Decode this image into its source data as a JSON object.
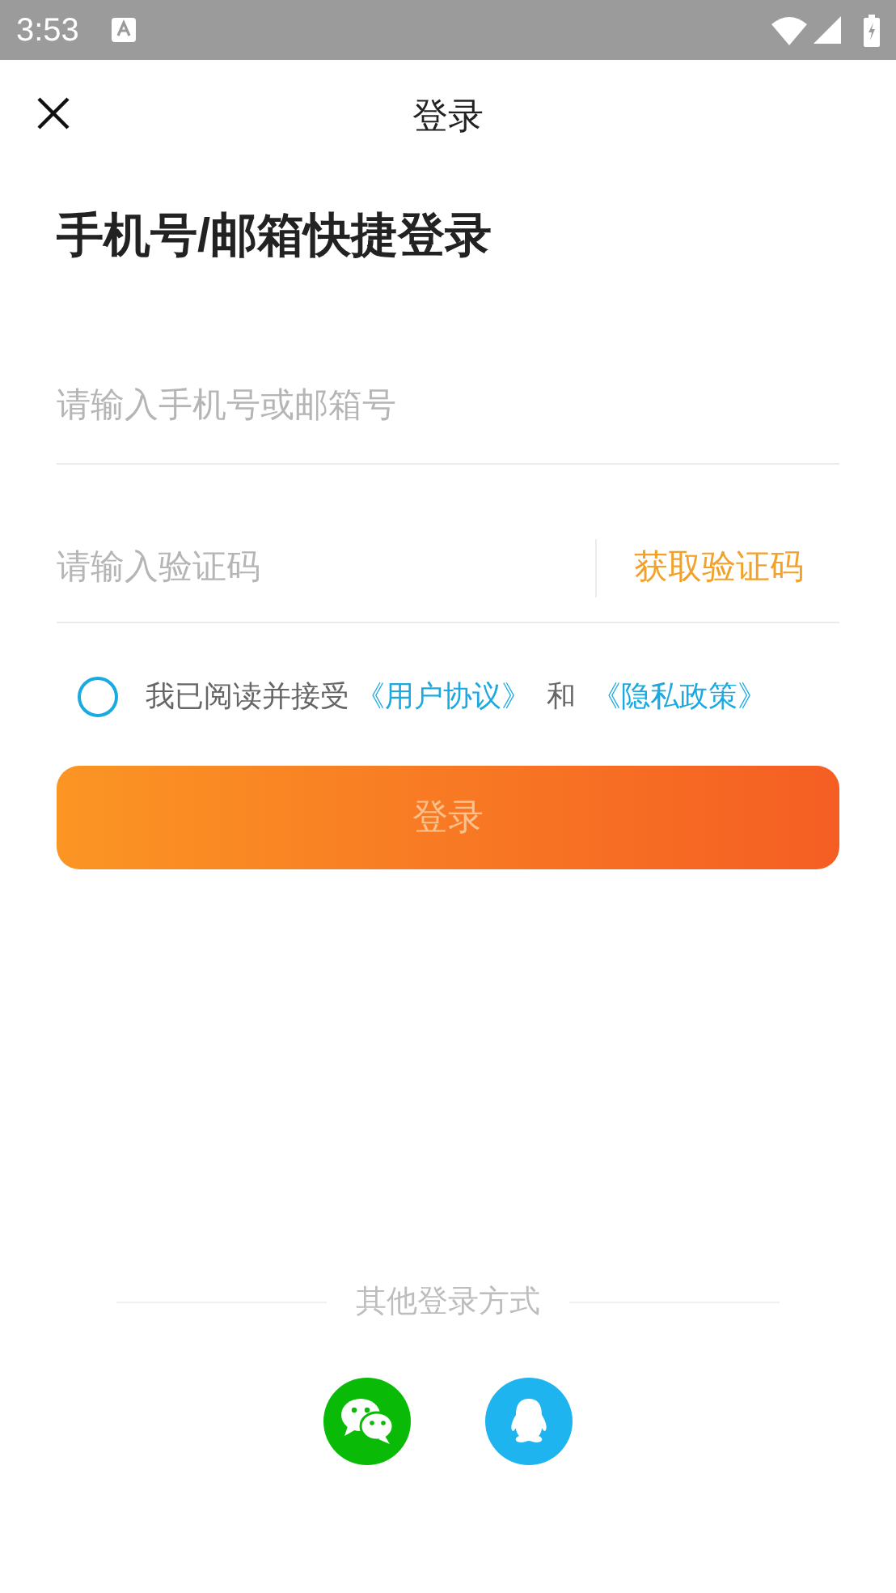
{
  "status_bar": {
    "time": "3:53"
  },
  "header": {
    "title": "登录"
  },
  "heading": "手机号/邮箱快捷登录",
  "phone_field": {
    "placeholder": "请输入手机号或邮箱号"
  },
  "code_field": {
    "placeholder": "请输入验证码",
    "action": "获取验证码"
  },
  "agreement": {
    "checked": false,
    "text": "我已阅读并接受",
    "link_1": "《用户协议》",
    "joiner": "和",
    "link_2": "《隐私政策》"
  },
  "login_button": {
    "label": "登录",
    "disabled": true
  },
  "other_login": {
    "label": "其他登录方式",
    "methods": [
      {
        "kind": "wechat",
        "color": "#09bb07"
      },
      {
        "kind": "qq",
        "color": "#1eb4f0"
      }
    ]
  }
}
